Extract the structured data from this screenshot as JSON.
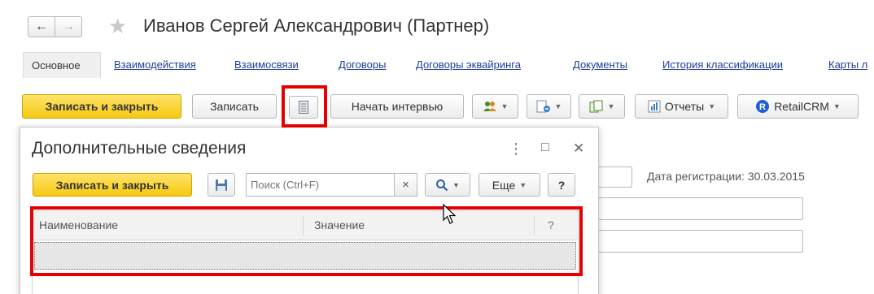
{
  "window": {
    "nav_back": "←",
    "nav_forward": "→",
    "title": "Иванов Сергей Александрович (Партнер)"
  },
  "tabs": [
    {
      "label": "Основное",
      "active": true
    },
    {
      "label": "Взаимодействия"
    },
    {
      "label": "Взаимосвязи"
    },
    {
      "label": "Договоры"
    },
    {
      "label": "Договоры эквайринга"
    },
    {
      "label": "Документы"
    },
    {
      "label": "История классификации"
    },
    {
      "label": "Карты л"
    }
  ],
  "toolbar": {
    "save_close": "Записать и закрыть",
    "save": "Записать",
    "start_interview": "Начать интервью",
    "reports": "Отчеты",
    "retailcrm": "RetailCRM"
  },
  "background_form": {
    "registration_date": "Дата регистрации: 30.03.2015"
  },
  "dialog": {
    "title": "Дополнительные сведения",
    "menu_icon": "⋮",
    "maximize_icon": "□",
    "close_icon": "✕",
    "save_close": "Записать и закрыть",
    "search_placeholder": "Поиск (Ctrl+F)",
    "clear": "×",
    "more": "Еще",
    "help": "?",
    "table": {
      "columns": [
        "Наименование",
        "Значение",
        "?"
      ],
      "rows": []
    }
  },
  "colors": {
    "primary_button": "#f6c912",
    "link": "#1f3d99",
    "highlight": "#e60000",
    "header_bg": "#f2f2f2"
  }
}
